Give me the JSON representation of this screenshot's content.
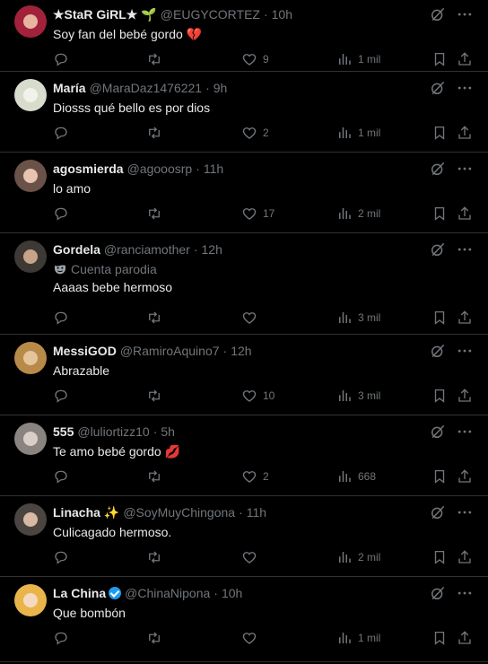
{
  "tweets": [
    {
      "name": "★StaR GiRL★",
      "name_emoji": "🌱",
      "handle": "@EUGYCORTEZ",
      "time": "10h",
      "text": "Soy fan del bebé gordo",
      "text_emoji": "💔",
      "likes": "9",
      "views": "1 mil",
      "parody": "",
      "verified": false,
      "avatar_color": "#a1223a",
      "face_color": "#e8b4a0"
    },
    {
      "name": "María",
      "name_emoji": "",
      "handle": "@MaraDaz1476221",
      "time": "9h",
      "text": "Diosss qué bello es por dios",
      "text_emoji": "",
      "likes": "2",
      "views": "1 mil",
      "parody": "",
      "verified": false,
      "avatar_color": "#d8dccd",
      "face_color": "#f2f2ea"
    },
    {
      "name": "agosmierda",
      "name_emoji": "",
      "handle": "@agooosrp",
      "time": "11h",
      "text": "lo amo",
      "text_emoji": "",
      "likes": "17",
      "views": "2 mil",
      "parody": "",
      "verified": false,
      "avatar_color": "#6b5248",
      "face_color": "#e7c3b0"
    },
    {
      "name": "Gordela",
      "name_emoji": "",
      "handle": "@ranciamother",
      "time": "12h",
      "text": "Aaaas bebe hermoso",
      "text_emoji": "",
      "likes": "",
      "views": "3 mil",
      "parody": "Cuenta parodia",
      "verified": false,
      "avatar_color": "#3d3a35",
      "face_color": "#c7a38a"
    },
    {
      "name": "MessiGOD",
      "name_emoji": "",
      "handle": "@RamiroAquino7",
      "time": "12h",
      "text": "Abrazable",
      "text_emoji": "",
      "likes": "10",
      "views": "3 mil",
      "parody": "",
      "verified": false,
      "avatar_color": "#b88a4a",
      "face_color": "#e6c49a"
    },
    {
      "name": "555",
      "name_emoji": "",
      "handle": "@luliortizz10",
      "time": "5h",
      "text": "Te amo bebé gordo",
      "text_emoji": "💋",
      "likes": "2",
      "views": "668",
      "parody": "",
      "verified": false,
      "avatar_color": "#8a8480",
      "face_color": "#d9cfc8"
    },
    {
      "name": "Linacha",
      "name_emoji": "✨",
      "handle": "@SoyMuyChingona",
      "time": "11h",
      "text": "Culicagado hermoso.",
      "text_emoji": "",
      "likes": "",
      "views": "2 mil",
      "parody": "",
      "verified": false,
      "avatar_color": "#4a4540",
      "face_color": "#d8b9a3"
    },
    {
      "name": "La China",
      "name_emoji": "",
      "handle": "@ChinaNipona",
      "time": "10h",
      "text": "Que bombón",
      "text_emoji": "",
      "likes": "",
      "views": "1 mil",
      "parody": "",
      "verified": true,
      "avatar_color": "#e9b54b",
      "face_color": "#f5d9c0"
    }
  ],
  "icons": {
    "grok": "grok-icon",
    "more": "more-icon",
    "reply": "reply-icon",
    "retweet": "retweet-icon",
    "like": "like-icon",
    "views": "views-icon",
    "bookmark": "bookmark-icon",
    "share": "share-icon",
    "parody": "mask-icon"
  },
  "colors": {
    "background": "#000000",
    "text": "#e7e9ea",
    "muted": "#71767b",
    "border": "#2f3336",
    "verified": "#1d9bf0"
  }
}
